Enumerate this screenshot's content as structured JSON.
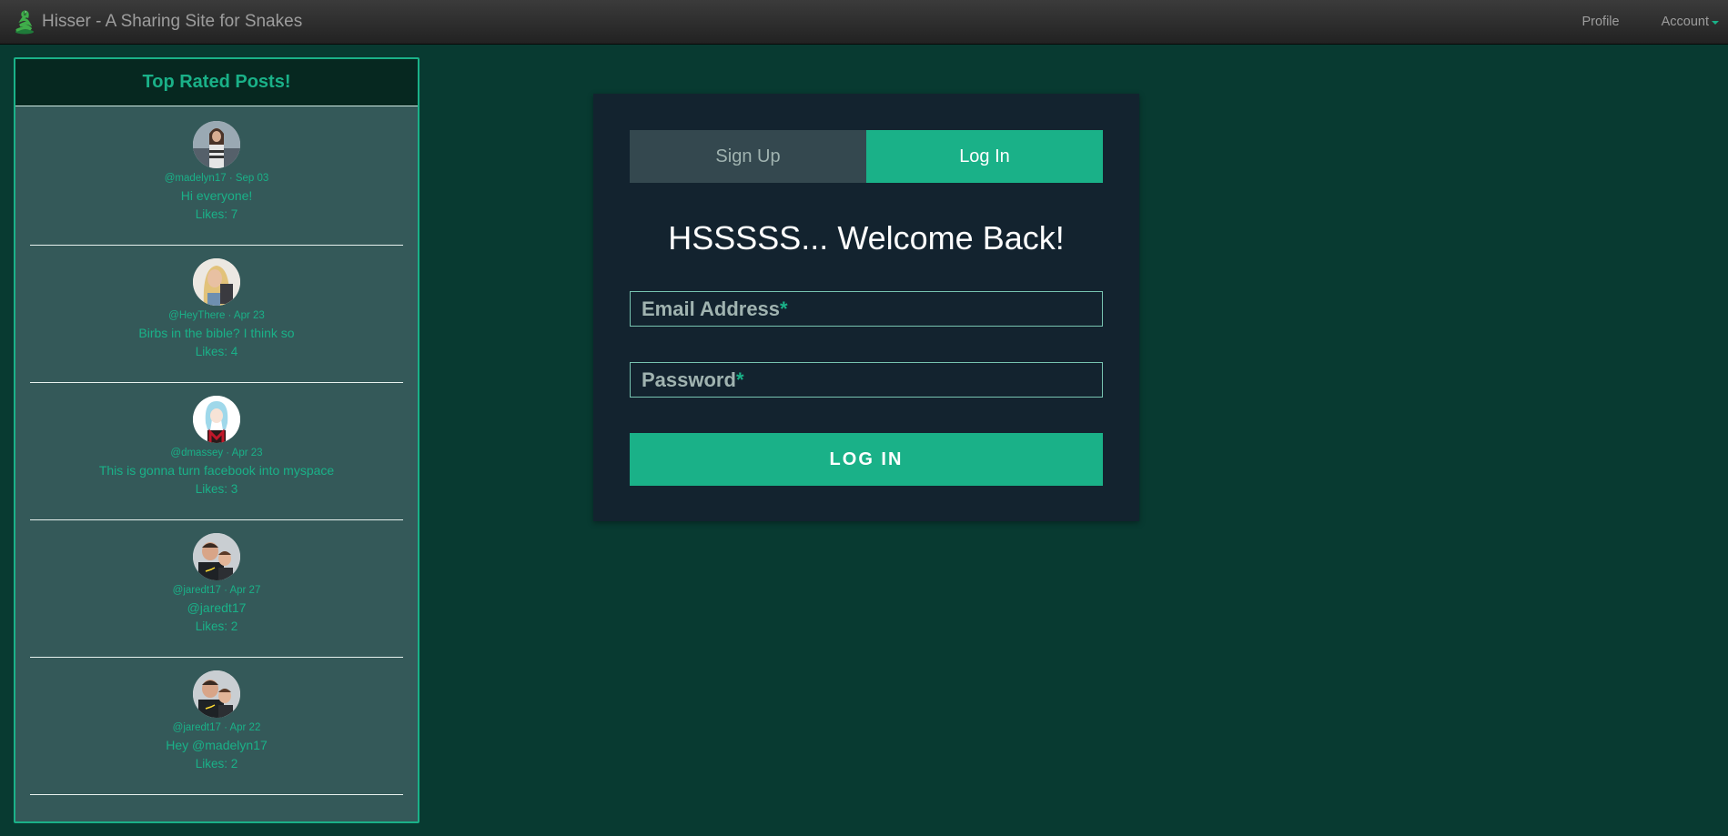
{
  "navbar": {
    "brand": "Hisser - A Sharing Site for Snakes",
    "profile": "Profile",
    "account": "Account"
  },
  "sidebar": {
    "title": "Top Rated Posts!",
    "posts": [
      {
        "meta": "@madelyn17 · Sep 03",
        "text": "Hi everyone!",
        "likes": "Likes: 7"
      },
      {
        "meta": "@HeyThere · Apr 23",
        "text": "Birbs in the bible? I think so",
        "likes": "Likes: 4"
      },
      {
        "meta": "@dmassey · Apr 23",
        "text": "This is gonna turn facebook into myspace",
        "likes": "Likes: 3"
      },
      {
        "meta": "@jaredt17 · Apr 27",
        "text": "@jaredt17",
        "likes": "Likes: 2"
      },
      {
        "meta": "@jaredt17 · Apr 22",
        "text": "Hey @madelyn17",
        "likes": "Likes: 2"
      }
    ]
  },
  "login": {
    "tab_signup": "Sign Up",
    "tab_login": "Log In",
    "heading": "HSSSSS... Welcome Back!",
    "email_label": "Email Address",
    "password_label": "Password",
    "required_mark": "*",
    "submit": "LOG IN"
  },
  "colors": {
    "accent": "#1ab188",
    "background": "#083a31",
    "card": "#13232f",
    "sidebar": "#345959"
  }
}
